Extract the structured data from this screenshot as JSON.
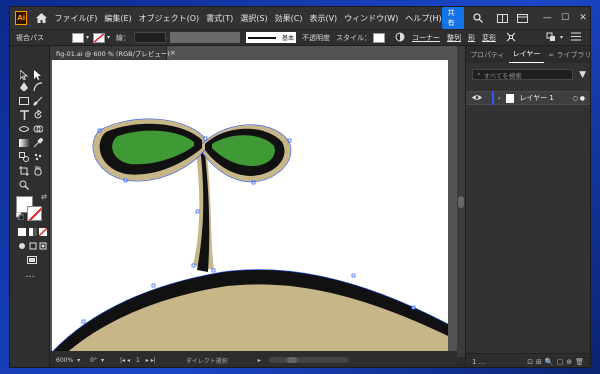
{
  "app": {
    "logo_text": "Ai"
  },
  "menu": [
    "ファイル(F)",
    "編集(E)",
    "オブジェクト(O)",
    "書式(T)",
    "選択(S)",
    "効果(C)",
    "表示(V)",
    "ウィンドウ(W)",
    "ヘルプ(H)"
  ],
  "titlebar": {
    "share_label": "共有",
    "minimize": "—",
    "maximize": "☐",
    "close": "✕"
  },
  "controlbar": {
    "mode_label": "複合パス",
    "stroke_label": "線：",
    "stroke_profile": "基本",
    "opacity_label": "不透明度",
    "style_label": "スタイル：",
    "corner_link": "コーナー",
    "align_link": "整列",
    "pathfinder_link": "形",
    "transform_link": "変形"
  },
  "document": {
    "tab_title": "fig-01.ai @ 600 % (RGB/プレビュー)",
    "tab_close": "×"
  },
  "statusbar": {
    "zoom": "600%",
    "rotation": "0°",
    "artboard": "1",
    "tool_status": "ダイレクト選択"
  },
  "layers_panel": {
    "tabs": [
      "プロパティ",
      "レイヤー",
      "ライブラリ"
    ],
    "active_tab": "レイヤー",
    "search_placeholder": "すべてを検索",
    "layers": [
      {
        "name": "レイヤー 1",
        "visible": true
      }
    ],
    "layer_count": "1 ..."
  },
  "colors": {
    "accent": "#1473e6",
    "leaf_green": "#3f9a35",
    "ground_tan": "#c7b687",
    "outline": "#111111"
  },
  "icons": [
    "home-icon",
    "search-icon",
    "arrange-documents-icon",
    "workspace-icon",
    "selection-tool-icon",
    "direct-selection-icon",
    "pen-tool-icon",
    "type-tool-icon",
    "eye-icon",
    "filter-icon"
  ]
}
